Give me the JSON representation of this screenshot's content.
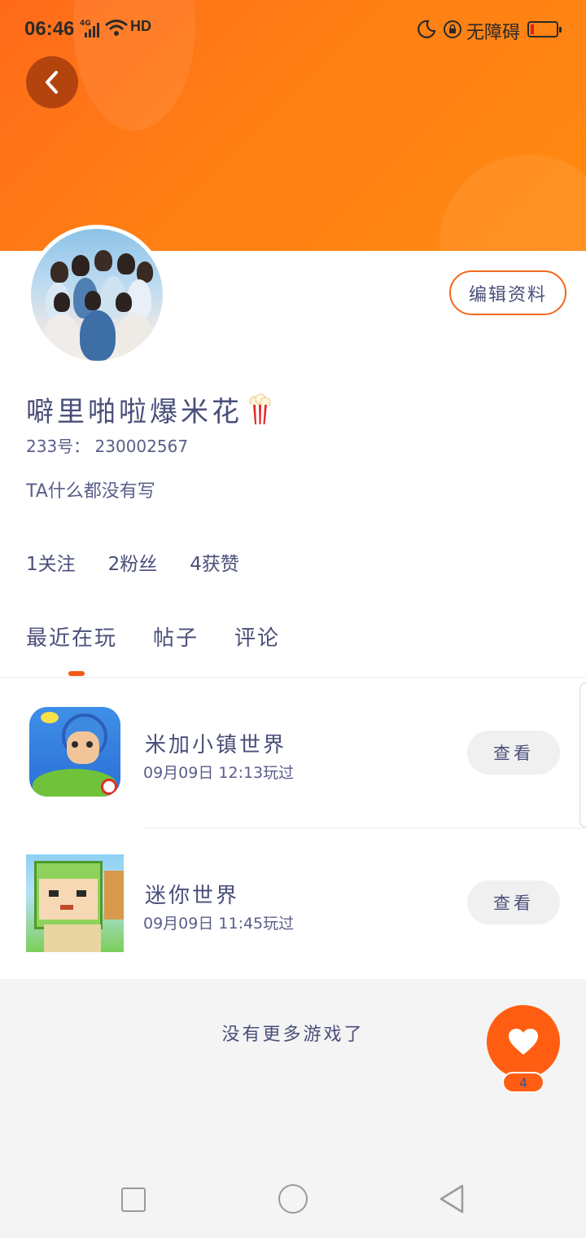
{
  "status_bar": {
    "time": "06:46",
    "network": "4G",
    "hd": "HD",
    "accessibility": "无障碍",
    "battery_level": 0.08
  },
  "header": {
    "back_icon": "chevron-left-icon",
    "edit_label": "编辑资料"
  },
  "profile": {
    "name": "噼里啪啦爆米花",
    "name_emoji": "popcorn-icon",
    "uid": "233号： 230002567",
    "bio": "TA什么都没有写",
    "stats": {
      "following": "1关注",
      "followers": "2粉丝",
      "likes": "4获赞"
    }
  },
  "tabs": [
    {
      "label": "最近在玩",
      "active": true
    },
    {
      "label": "帖子",
      "active": false
    },
    {
      "label": "评论",
      "active": false
    }
  ],
  "games": [
    {
      "title": "米加小镇世界",
      "played": "09月09日 12:13玩过",
      "action": "查看"
    },
    {
      "title": "迷你世界",
      "played": "09月09日 11:45玩过",
      "action": "查看"
    }
  ],
  "footer": {
    "no_more": "没有更多游戏了"
  },
  "like_widget": {
    "icon": "heart-icon",
    "count": "4"
  },
  "colors": {
    "accent": "#ff5e12",
    "banner_start": "#ff6a1a",
    "banner_end": "#ff8a12",
    "text": "#4a4f7a"
  }
}
